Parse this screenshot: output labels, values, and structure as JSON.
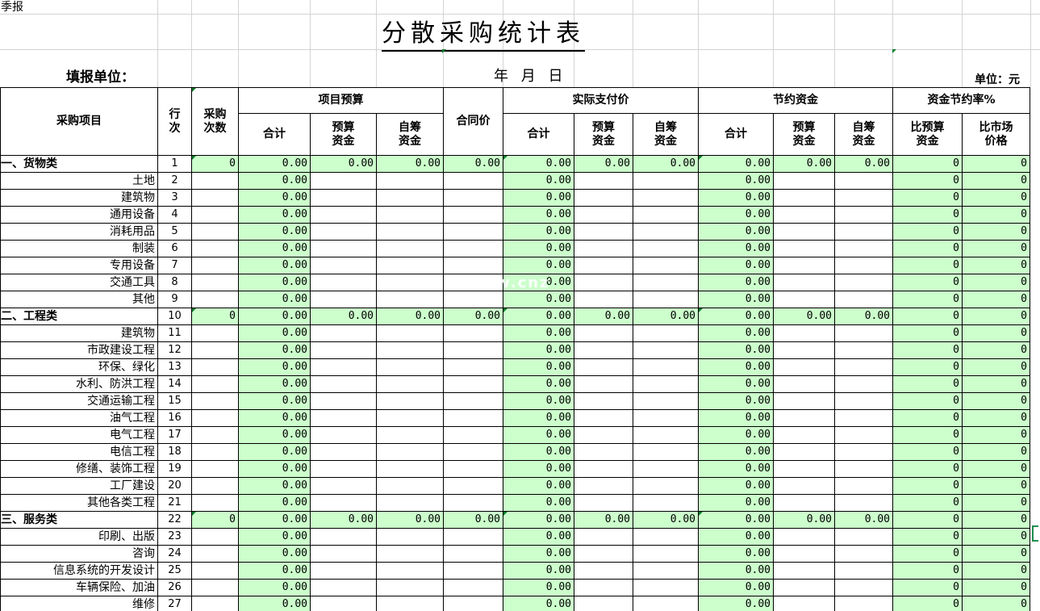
{
  "sheet": {
    "corner_label": "季报",
    "title": "分散采购统计表",
    "unit_label": "填报单位：",
    "date_label": "年  月  日",
    "currency_label": "单位：元",
    "watermark": "www.cnz"
  },
  "headers": {
    "item": "采购项目",
    "row_no": "行次",
    "count": "采购次数",
    "budget": "项目预算",
    "contract": "合同价",
    "actual": "实际支付价",
    "savings": "节约资金",
    "rate": "资金节约率%",
    "total": "合计",
    "budget_funds": "预算资金",
    "self_funds": "自筹资金",
    "vs_budget": "比预算资金",
    "vs_market": "比市场价格"
  },
  "rows": [
    {
      "kind": "cat",
      "name": "一、货物类",
      "no": "1"
    },
    {
      "kind": "item",
      "name": "土地",
      "no": "2"
    },
    {
      "kind": "item",
      "name": "建筑物",
      "no": "3"
    },
    {
      "kind": "item",
      "name": "通用设备",
      "no": "4"
    },
    {
      "kind": "item",
      "name": "消耗用品",
      "no": "5"
    },
    {
      "kind": "item",
      "name": "制装",
      "no": "6"
    },
    {
      "kind": "item",
      "name": "专用设备",
      "no": "7"
    },
    {
      "kind": "item",
      "name": "交通工具",
      "no": "8"
    },
    {
      "kind": "item",
      "name": "其他",
      "no": "9"
    },
    {
      "kind": "cat",
      "name": "二、工程类",
      "no": "10"
    },
    {
      "kind": "item",
      "name": "建筑物",
      "no": "11"
    },
    {
      "kind": "item",
      "name": "市政建设工程",
      "no": "12"
    },
    {
      "kind": "item",
      "name": "环保、绿化",
      "no": "13"
    },
    {
      "kind": "item",
      "name": "水利、防洪工程",
      "no": "14"
    },
    {
      "kind": "item",
      "name": "交通运输工程",
      "no": "15"
    },
    {
      "kind": "item",
      "name": "油气工程",
      "no": "16"
    },
    {
      "kind": "item",
      "name": "电气工程",
      "no": "17"
    },
    {
      "kind": "item",
      "name": "电信工程",
      "no": "18"
    },
    {
      "kind": "item",
      "name": "修缮、装饰工程",
      "no": "19"
    },
    {
      "kind": "item",
      "name": "工厂建设",
      "no": "20"
    },
    {
      "kind": "item",
      "name": "其他各类工程",
      "no": "21"
    },
    {
      "kind": "cat",
      "name": "三、服务类",
      "no": "22"
    },
    {
      "kind": "item",
      "name": "印刷、出版",
      "no": "23"
    },
    {
      "kind": "item",
      "name": "咨询",
      "no": "24"
    },
    {
      "kind": "item",
      "name": "信息系统的开发设计",
      "no": "25"
    },
    {
      "kind": "item",
      "name": "车辆保险、加油",
      "no": "26"
    },
    {
      "kind": "item",
      "name": "维修",
      "no": "27"
    }
  ],
  "values": {
    "zero_int": "0",
    "zero_money": "0.00"
  },
  "colors": {
    "green_fill": "#ccffcc",
    "grid": "#d4d4d4",
    "comment_marker": "#0a7d2c"
  }
}
